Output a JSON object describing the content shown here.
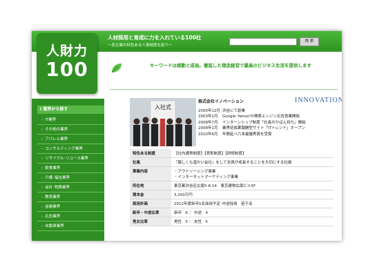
{
  "header": {
    "title": "人材採用と育成に力を入れている100社",
    "subtitle": "〜各企業の特色ある人事制度を紹介〜",
    "search_placeholder": "",
    "search_button": "検 索"
  },
  "logo": {
    "top": "人財力",
    "number": "100"
  },
  "sidebar": {
    "header": "I 業界から探す",
    "items": [
      "IT業界",
      "その他の業界",
      "アパレル業界",
      "コンサルティング業界",
      "リサイクル･リユース業界",
      "飲食業界",
      "介護･福祉業界",
      "会計･税務業界",
      "教育業界",
      "金融業界",
      "広告業界",
      "自動車業界"
    ]
  },
  "keyword": "キーワードは感動と成長。徹底した理念経営で最高のビジネス生活を提供します",
  "company": {
    "name": "株式会社イノベーション",
    "brand": "INNOVATION",
    "photo_sign": "入社式",
    "history": [
      {
        "date": "2000年12月",
        "event": "渋谷にて創業"
      },
      {
        "date": "2003年1月",
        "event": "Google･Yahoo!の検索エンジン広告営業開始"
      },
      {
        "date": "2008年7月",
        "event": "インターンシップ制度「社長のかばん持ち」開始"
      },
      {
        "date": "2008年1月",
        "event": "業界初成果報酬型サイト「ITトレンド」オープン"
      },
      {
        "date": "2010年6月",
        "event": "年間延べ六本最優秀賞を受賞"
      }
    ],
    "info": [
      {
        "label": "特色ある制度",
        "value": "【社内通貨制度】【表彰制度】【研修制度】"
      },
      {
        "label": "社風",
        "value": "『厳しくも温かい会社』をして全員が成長することを大切にする社風"
      },
      {
        "label": "事業内容",
        "value": "・アウトソーシング事業\n・インターネットマーケティング事業"
      },
      {
        "label": "所在地",
        "value": "東京都渋谷区広尾5-8-14　東京建物広尾ビル5F"
      },
      {
        "label": "資本金",
        "value": "3,200万円"
      },
      {
        "label": "採用計画",
        "value": "2012年度新卒5名採用予定･中途採用　若干名"
      },
      {
        "label": "新卒・中途比率",
        "value": "新卒　6 ： 中途　4"
      },
      {
        "label": "男女比率",
        "value": "男性　5 ： 女性　5"
      }
    ]
  },
  "colors": {
    "primary_green": "#2f8f23",
    "header_green": "#3aa62a",
    "keyword_green": "#2d9a1e",
    "brand_blue": "#2a5d9a"
  },
  "icons": {
    "leaf": "leaf-icon"
  }
}
